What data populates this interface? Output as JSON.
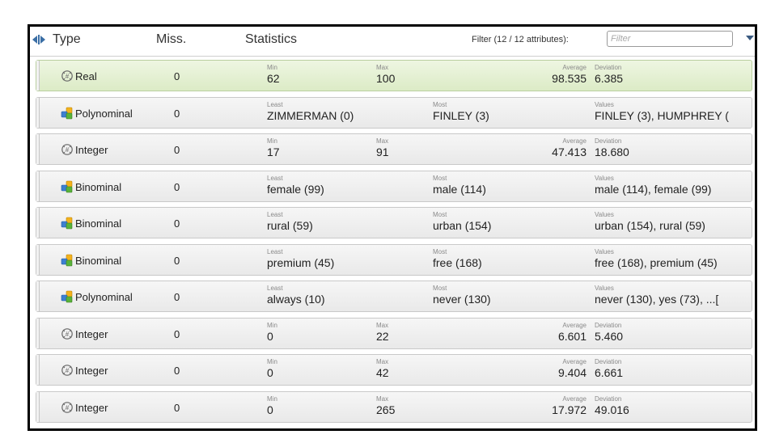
{
  "header": {
    "type_label": "Type",
    "missing_label": "Miss.",
    "statistics_label": "Statistics",
    "filter_label": "Filter (12 / 12 attributes):",
    "filter_placeholder": "Filter"
  },
  "icons": {
    "numeric": "numeric-attribute-icon",
    "nominal": "nominal-attribute-icon"
  },
  "colors": {
    "selected_row": "#dcebc6",
    "row": "#e9e9e9"
  },
  "rows": [
    {
      "type": "Real",
      "missing": "0",
      "kind": "numeric",
      "cells": [
        {
          "caption": "Min",
          "value": "62"
        },
        {
          "caption": "Max",
          "value": "100"
        },
        {
          "caption": "Average",
          "value": "98.535"
        },
        {
          "caption": "Deviation",
          "value": "6.385"
        }
      ]
    },
    {
      "type": "Polynominal",
      "missing": "0",
      "kind": "nominal",
      "cells": [
        {
          "caption": "Least",
          "value": "ZIMMERMAN (0)"
        },
        {
          "caption": "Most",
          "value": "FINLEY (3)"
        },
        {
          "caption": "Values",
          "value": "FINLEY (3), HUMPHREY ("
        }
      ]
    },
    {
      "type": "Integer",
      "missing": "0",
      "kind": "numeric",
      "cells": [
        {
          "caption": "Min",
          "value": "17"
        },
        {
          "caption": "Max",
          "value": "91"
        },
        {
          "caption": "Average",
          "value": "47.413"
        },
        {
          "caption": "Deviation",
          "value": "18.680"
        }
      ]
    },
    {
      "type": "Binominal",
      "missing": "0",
      "kind": "nominal",
      "cells": [
        {
          "caption": "Least",
          "value": "female (99)"
        },
        {
          "caption": "Most",
          "value": "male (114)"
        },
        {
          "caption": "Values",
          "value": "male (114), female (99)"
        }
      ]
    },
    {
      "type": "Binominal",
      "missing": "0",
      "kind": "nominal",
      "cells": [
        {
          "caption": "Least",
          "value": "rural (59)"
        },
        {
          "caption": "Most",
          "value": "urban (154)"
        },
        {
          "caption": "Values",
          "value": "urban (154), rural (59)"
        }
      ]
    },
    {
      "type": "Binominal",
      "missing": "0",
      "kind": "nominal",
      "cells": [
        {
          "caption": "Least",
          "value": "premium (45)"
        },
        {
          "caption": "Most",
          "value": "free (168)"
        },
        {
          "caption": "Values",
          "value": "free (168), premium (45)"
        }
      ]
    },
    {
      "type": "Polynominal",
      "missing": "0",
      "kind": "nominal",
      "cells": [
        {
          "caption": "Least",
          "value": "always (10)"
        },
        {
          "caption": "Most",
          "value": "never (130)"
        },
        {
          "caption": "Values",
          "value": "never (130), yes (73), ...["
        }
      ]
    },
    {
      "type": "Integer",
      "missing": "0",
      "kind": "numeric",
      "cells": [
        {
          "caption": "Min",
          "value": "0"
        },
        {
          "caption": "Max",
          "value": "22"
        },
        {
          "caption": "Average",
          "value": "6.601"
        },
        {
          "caption": "Deviation",
          "value": "5.460"
        }
      ]
    },
    {
      "type": "Integer",
      "missing": "0",
      "kind": "numeric",
      "cells": [
        {
          "caption": "Min",
          "value": "0"
        },
        {
          "caption": "Max",
          "value": "42"
        },
        {
          "caption": "Average",
          "value": "9.404"
        },
        {
          "caption": "Deviation",
          "value": "6.661"
        }
      ]
    },
    {
      "type": "Integer",
      "missing": "0",
      "kind": "numeric",
      "cells": [
        {
          "caption": "Min",
          "value": "0"
        },
        {
          "caption": "Max",
          "value": "265"
        },
        {
          "caption": "Average",
          "value": "17.972"
        },
        {
          "caption": "Deviation",
          "value": "49.016"
        }
      ]
    }
  ]
}
